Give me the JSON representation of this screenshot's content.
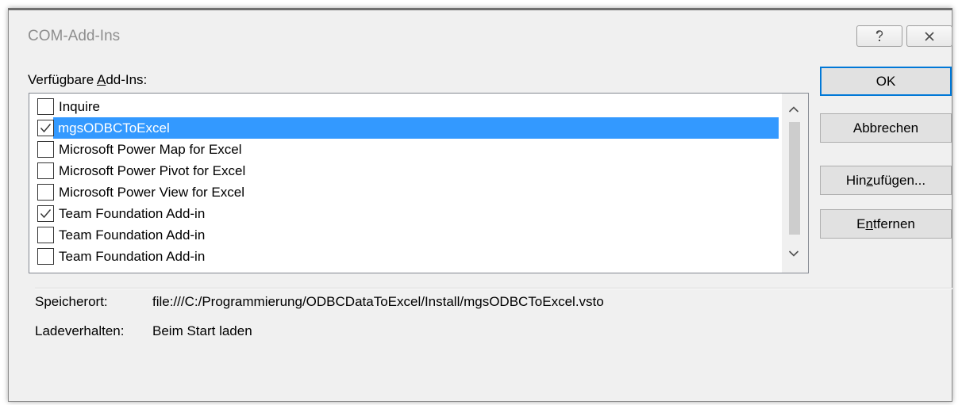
{
  "dialog": {
    "title": "COM-Add-Ins",
    "help_icon": "help-icon",
    "close_icon": "close-icon"
  },
  "list": {
    "label_before": "Verfügbare ",
    "label_accel": "A",
    "label_after": "dd-Ins:",
    "items": [
      {
        "label": "Inquire",
        "checked": false,
        "selected": false
      },
      {
        "label": "mgsODBCToExcel",
        "checked": true,
        "selected": true
      },
      {
        "label": "Microsoft Power Map for Excel",
        "checked": false,
        "selected": false
      },
      {
        "label": "Microsoft Power Pivot for Excel",
        "checked": false,
        "selected": false
      },
      {
        "label": "Microsoft Power View for Excel",
        "checked": false,
        "selected": false
      },
      {
        "label": "Team Foundation Add-in",
        "checked": true,
        "selected": false
      },
      {
        "label": "Team Foundation Add-in",
        "checked": false,
        "selected": false
      },
      {
        "label": "Team Foundation Add-in",
        "checked": false,
        "selected": false
      }
    ]
  },
  "buttons": {
    "ok": "OK",
    "cancel": "Abbrechen",
    "add_before": "Hin",
    "add_accel": "z",
    "add_after": "ufügen...",
    "remove_before": "E",
    "remove_accel": "n",
    "remove_after": "tfernen"
  },
  "info": {
    "location_label": "Speicherort:",
    "location_value": "file:///C:/Programmierung/ODBCDataToExcel/Install/mgsODBCToExcel.vsto",
    "load_label": "Ladeverhalten:",
    "load_value": "Beim Start laden"
  },
  "colors": {
    "selection": "#3399ff",
    "dialog_bg": "#f0f0f0",
    "default_button_border": "#0078d7"
  }
}
